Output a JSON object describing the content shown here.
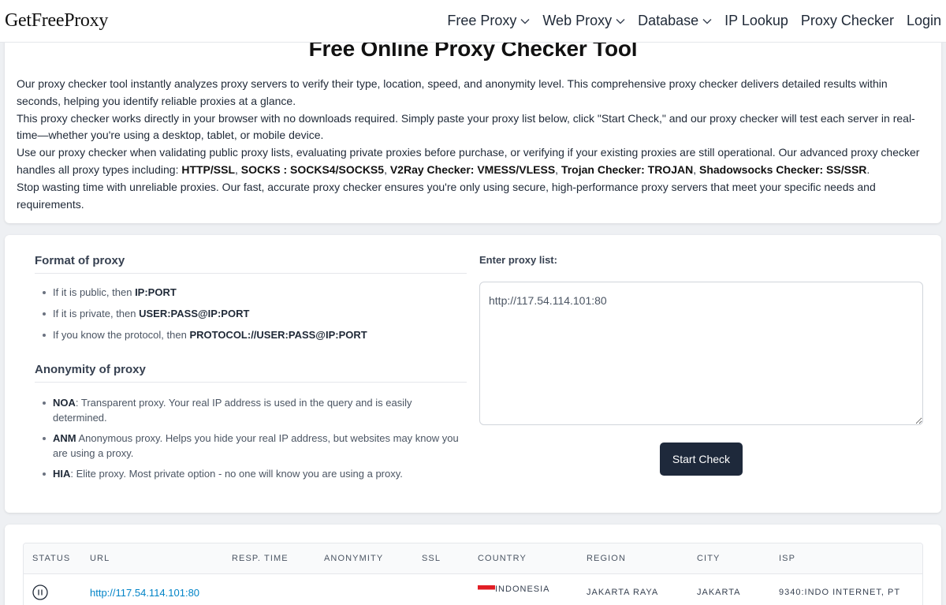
{
  "header": {
    "logo": "GetFreeProxy",
    "nav": [
      {
        "label": "Free Proxy",
        "dropdown": true
      },
      {
        "label": "Web Proxy",
        "dropdown": true
      },
      {
        "label": "Database",
        "dropdown": true
      },
      {
        "label": "IP Lookup",
        "dropdown": false
      },
      {
        "label": "Proxy Checker",
        "dropdown": false
      },
      {
        "label": "Login",
        "dropdown": false
      }
    ]
  },
  "intro": {
    "title": "Free Online Proxy Checker Tool",
    "p1": "Our proxy checker tool instantly analyzes proxy servers to verify their type, location, speed, and anonymity level. This comprehensive proxy checker delivers detailed results within seconds, helping you identify reliable proxies at a glance.",
    "p2": "This proxy checker works directly in your browser with no downloads required. Simply paste your proxy list below, click \"Start Check,\" and our proxy checker will test each server in real-time—whether you're using a desktop, tablet, or mobile device.",
    "p3_lead": "Use our proxy checker when validating public proxy lists, evaluating private proxies before purchase, or verifying if your existing proxies are still operational. Our advanced proxy checker handles all proxy types including: ",
    "p3_types": [
      "HTTP/SSL",
      "SOCKS : SOCKS4/SOCKS5",
      "V2Ray Checker: VMESS/VLESS",
      "Trojan Checker: TROJAN",
      "Shadowsocks Checker: SS/SSR"
    ],
    "p3_sep": ", ",
    "p3_end": ".",
    "p4": "Stop wasting time with unreliable proxies. Our fast, accurate proxy checker ensures you're only using secure, high-performance proxy servers that meet your specific needs and requirements."
  },
  "format": {
    "title": "Format of proxy",
    "items": [
      {
        "text": "If it is public, then ",
        "bold": "IP:PORT"
      },
      {
        "text": "If it is private, then ",
        "bold": "USER:PASS@IP:PORT"
      },
      {
        "text": "If you know the protocol, then ",
        "bold": "PROTOCOL://USER:PASS@IP:PORT"
      }
    ]
  },
  "anonymity": {
    "title": "Anonymity of proxy",
    "items": [
      {
        "bold": "NOA",
        "text": ": Transparent proxy. Your real IP address is used in the query and is easily determined."
      },
      {
        "bold": "ANM",
        "text": " Anonymous proxy. Helps you hide your real IP address, but websites may know you are using a proxy."
      },
      {
        "bold": "HIA",
        "text": ": Elite proxy. Most private option - no one will know you are using a proxy."
      }
    ]
  },
  "checker": {
    "label": "Enter proxy list:",
    "input_value": "http://117.54.114.101:80",
    "button": "Start Check"
  },
  "table": {
    "columns": [
      "STATUS",
      "URL",
      "RESP. TIME",
      "ANONYMITY",
      "SSL",
      "COUNTRY",
      "REGION",
      "CITY",
      "ISP"
    ],
    "rows": [
      {
        "status": "paused-icon",
        "url": "http://117.54.114.101:80",
        "resp_time": "",
        "anonymity": "",
        "ssl": "",
        "country": "INDONESIA",
        "region": "JAKARTA RAYA",
        "city": "JAKARTA",
        "isp": "9340:INDO INTERNET, PT"
      }
    ]
  },
  "colors": {
    "button_bg": "#1e293b",
    "link": "#0284c7",
    "page_bg": "#eef0f3"
  }
}
